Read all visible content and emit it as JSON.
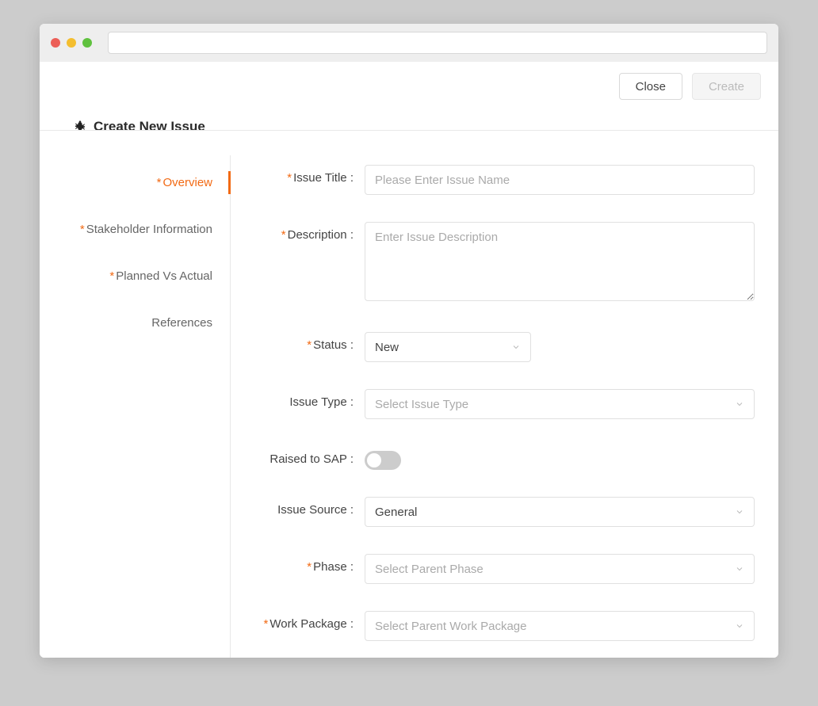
{
  "buttons": {
    "close": "Close",
    "create": "Create"
  },
  "page": {
    "title": "Create New Issue"
  },
  "tabs": [
    {
      "label": "Overview",
      "required": true,
      "active": true
    },
    {
      "label": "Stakeholder Information",
      "required": true,
      "active": false
    },
    {
      "label": "Planned Vs Actual",
      "required": true,
      "active": false
    },
    {
      "label": "References",
      "required": false,
      "active": false
    }
  ],
  "form": {
    "issueTitle": {
      "label": "Issue Title :",
      "placeholder": "Please Enter Issue Name",
      "required": true
    },
    "description": {
      "label": "Description :",
      "placeholder": "Enter Issue Description",
      "required": true
    },
    "status": {
      "label": "Status :",
      "value": "New",
      "required": true
    },
    "issueType": {
      "label": "Issue Type :",
      "placeholder": "Select Issue Type",
      "required": false
    },
    "raisedToSap": {
      "label": "Raised to SAP :",
      "value": false,
      "required": false
    },
    "issueSource": {
      "label": "Issue Source :",
      "value": "General",
      "required": false
    },
    "phase": {
      "label": "Phase :",
      "placeholder": "Select Parent Phase",
      "required": true
    },
    "workPackage": {
      "label": "Work Package :",
      "placeholder": "Select Parent Work Package",
      "required": true
    }
  }
}
